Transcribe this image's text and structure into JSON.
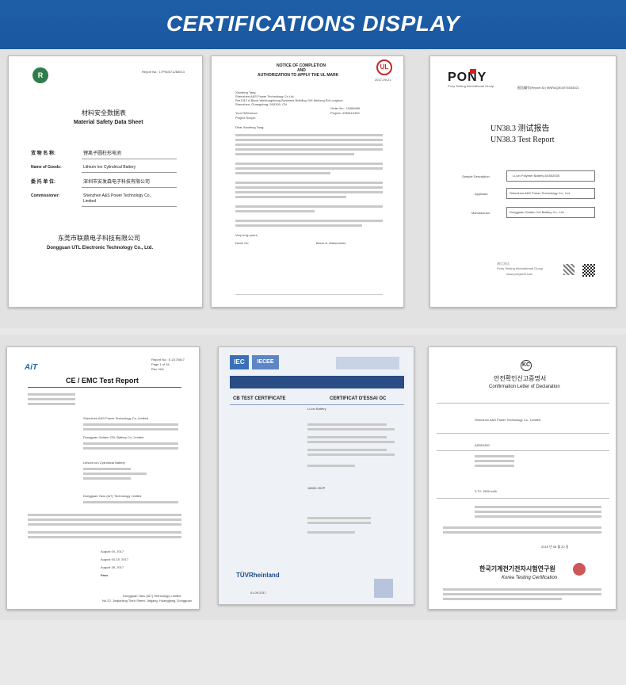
{
  "header": {
    "title": "CERTIFICATIONS DISPLAY"
  },
  "colors": {
    "banner": "#1e5fa8",
    "background": "#e9e9e9"
  },
  "certificates": [
    {
      "id": "msds",
      "report_no": "Report No.: 17PN0071260013",
      "title_cn": "材料安全数据表",
      "title_en": "Material Safety Data Sheet",
      "goods_cn_label": "货 物 名 称:",
      "goods_cn_value": "锂离子圆柱形电池",
      "goods_en_label": "Name of Goods:",
      "goods_en_value": "Lithium Ion Cylindrical Battery",
      "commissioner_cn_label": "委 托 单 位:",
      "commissioner_cn_value": "深圳市安发森电子科技有限公司",
      "commissioner_en_label": "Commissioner:",
      "commissioner_en_value_1": "Shenzhen A&S Power Technology Co.,",
      "commissioner_en_value_2": "Limited",
      "issuer_cn": "东莞市联鼎电子科技有限公司",
      "issuer_en": "Dongguan UTL Electronic Technology Co., Ltd."
    },
    {
      "id": "ul",
      "head_1": "NOTICE OF COMPLETION",
      "head_2": "AND",
      "head_3": "AUTHORIZATION TO APPLY THE UL MARK",
      "logo": "UL",
      "date": "2017-09-21",
      "addressee_1": "Xiaofeng Tang",
      "addressee_2": "Shenzhen A&S Power Technology Co Ltd",
      "addressee_3": "Rm1312 A Block Weidongsheng Business Building 194 Meilong Rd Longhua",
      "addressee_4": "Shenzhen, Guangdong, 518109, CN",
      "ref_label": "Your Reference:",
      "scope_label": "Project Scope:",
      "order_no": "Order No.: 11066499",
      "project_no": "Project: 4788116193",
      "greeting": "Dear Xiaofeng Tang:",
      "signer_1": "Devin Ho",
      "signer_2": "Bruce A. Mahrenholz",
      "closing": "Very truly yours,"
    },
    {
      "id": "un383",
      "brand": "PONY",
      "sub_brand": "Pony Testing International Group",
      "report_id": "报告编号(Report ID) MNRAQELW76534521",
      "title_cn": "UN38.3 测试报告",
      "title_en": "UN38.3 Test Report",
      "sample_label": "Sample Description",
      "sample_value": "Li-ion Polymer Battery AS552035",
      "applicant_label": "Applicant",
      "applicant_value": "Shenzhen A&S Power Technology Co., Ltd.",
      "manufacturer_label": "Manufacturer",
      "manufacturer_value": "Dongguan Golden Cel Battery Co., Ltd.",
      "seal_text": "谱尼测试",
      "footer_brand": "Pony Testing International Group",
      "footer_url": "www.ponytest.com"
    },
    {
      "id": "ce_emc",
      "brand": "AiT",
      "report_no": "Report No.: E-U170817",
      "page": "Page 1 of 34",
      "rev": "Rev. N/A",
      "title": "CE / EMC Test Report",
      "applicant_value": "Shenzhen A&S Power Technology Co.,Limited",
      "manufacturer_value": "Dongguan Golden CEL Battery Co.,Limited",
      "product_value": "Lithium Ion Cylindrical Battery",
      "lab_value": "Dongguan Yaxu (AiT) Technology Limited",
      "receipt_date": "August 04, 2017",
      "test_date": "August 04-15, 2017",
      "issue_date": "August 28, 2017",
      "result": "Pass",
      "footer_1": "Dongguan Yaxu (AiT) Technology Limited",
      "footer_2": "No.22, Jinqianling Third Street, Jitigang, Huangjiang, Dongguan"
    },
    {
      "id": "iec_cb",
      "logo_1": "IEC",
      "logo_2": "IECEE",
      "cb_title_en": "CB TEST CERTIFICATE",
      "cb_title_fr": "CERTIFICAT D'ESSAI OC",
      "product": "Li-ion Battery",
      "model": "18650-3S2P",
      "footer": "TÜVRheinland",
      "date": "01.09.2017"
    },
    {
      "id": "kc",
      "mark": "KC",
      "title_kr": "안전확인신고증명서",
      "title_en": "Confirmation Letter of Declaration",
      "applicant": "Shenzhen A&S Power Technology Co., Limited",
      "model": "AS652450",
      "rating": "3.7V, 1500 mAh",
      "issuer_kr": "한국기계전기전자시험연구원",
      "issuer_en": "Korea Testing Certification",
      "date": "2018 년 08 월 20 일"
    }
  ]
}
